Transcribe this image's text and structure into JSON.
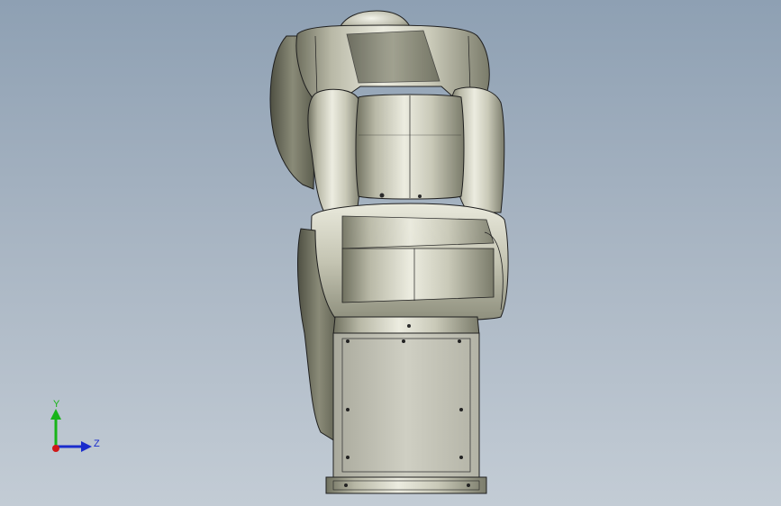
{
  "viewport": {
    "background_top": "#8ea0b3",
    "background_bottom": "#c3ccd5",
    "model_name": "six-axis-robot-arm",
    "model_color": "#b9b9aa",
    "edge_color": "#1f1f1f"
  },
  "triad": {
    "y_label": "Y",
    "z_label": "Z",
    "y_color": "#18b418",
    "z_color": "#1a2ccc",
    "x_color": "#d01818"
  }
}
